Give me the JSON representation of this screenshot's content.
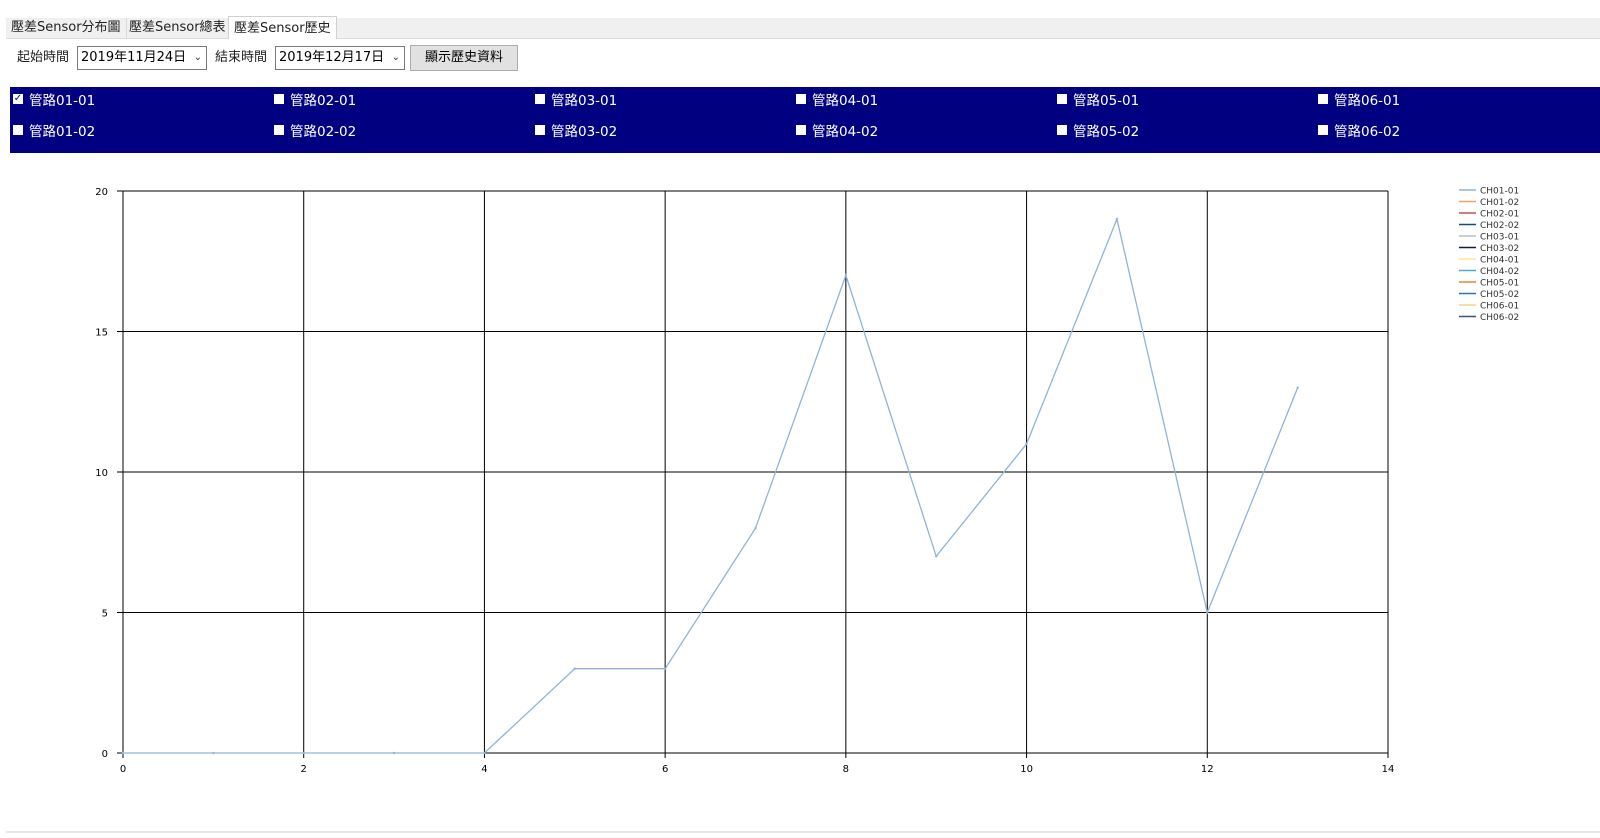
{
  "tabs": [
    {
      "label": "壓差Sensor分布圖",
      "active": false
    },
    {
      "label": "壓差Sensor總表",
      "active": false
    },
    {
      "label": "壓差Sensor歷史",
      "active": true
    }
  ],
  "toolbar": {
    "start_label": "起始時間",
    "start_value": "2019年11月24日",
    "end_label": "結束時間",
    "end_value": "2019年12月17日",
    "show_button": "顯示歷史資料"
  },
  "pipes": [
    {
      "label": "管路01-01",
      "checked": true
    },
    {
      "label": "管路02-01",
      "checked": false
    },
    {
      "label": "管路03-01",
      "checked": false
    },
    {
      "label": "管路04-01",
      "checked": false
    },
    {
      "label": "管路05-01",
      "checked": false
    },
    {
      "label": "管路06-01",
      "checked": false
    },
    {
      "label": "管路01-02",
      "checked": false
    },
    {
      "label": "管路02-02",
      "checked": false
    },
    {
      "label": "管路03-02",
      "checked": false
    },
    {
      "label": "管路04-02",
      "checked": false
    },
    {
      "label": "管路05-02",
      "checked": false
    },
    {
      "label": "管路06-02",
      "checked": false
    }
  ],
  "colors": {
    "checkbar_bg": "#000080",
    "data_line": "#8fb4d8",
    "grid": "#000000"
  },
  "chart_data": {
    "type": "line",
    "title": "",
    "xlabel": "",
    "ylabel": "",
    "xlim": [
      0,
      14
    ],
    "ylim": [
      0,
      20
    ],
    "x_ticks": [
      0,
      2,
      4,
      6,
      8,
      10,
      12,
      14
    ],
    "y_ticks": [
      0,
      5,
      10,
      15,
      20
    ],
    "grid": true,
    "legend_position": "top-right",
    "series": [
      {
        "name": "CH01-01",
        "color": "#8fb4d8",
        "x": [
          0,
          1,
          2,
          3,
          4,
          5,
          6,
          7,
          8,
          9,
          10,
          11,
          12,
          13
        ],
        "y": [
          0,
          0,
          0,
          0,
          0,
          3,
          3,
          8,
          17,
          7,
          11,
          19,
          5,
          13
        ]
      },
      {
        "name": "CH01-02",
        "color": "#f4a259",
        "x": [],
        "y": []
      },
      {
        "name": "CH02-01",
        "color": "#c0504d",
        "x": [],
        "y": []
      },
      {
        "name": "CH02-02",
        "color": "#1f497d",
        "x": [],
        "y": []
      },
      {
        "name": "CH03-01",
        "color": "#bfbfbf",
        "x": [],
        "y": []
      },
      {
        "name": "CH03-02",
        "color": "#0f1f3f",
        "x": [],
        "y": []
      },
      {
        "name": "CH04-01",
        "color": "#ffe699",
        "x": [],
        "y": []
      },
      {
        "name": "CH04-02",
        "color": "#4bacc6",
        "x": [],
        "y": []
      },
      {
        "name": "CH05-01",
        "color": "#e0873c",
        "x": [],
        "y": []
      },
      {
        "name": "CH05-02",
        "color": "#2e75b6",
        "x": [],
        "y": []
      },
      {
        "name": "CH06-01",
        "color": "#f9d089",
        "x": [],
        "y": []
      },
      {
        "name": "CH06-02",
        "color": "#44546a",
        "x": [],
        "y": []
      }
    ]
  }
}
